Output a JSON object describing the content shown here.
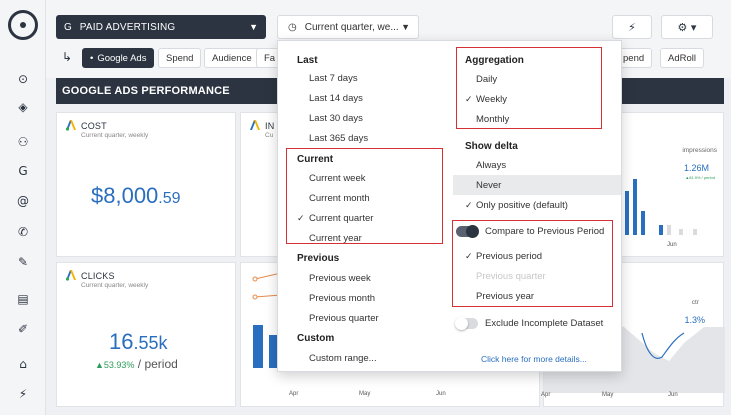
{
  "topbar": {
    "source_label": "PAID ADVERTISING",
    "date_label": "Current quarter, we...",
    "tabs": [
      {
        "label": "Google Ads",
        "active": true
      },
      {
        "label": "Spend"
      },
      {
        "label": "Audience"
      },
      {
        "label": "Fa"
      },
      {
        "label": "pend"
      },
      {
        "label": "AdRoll"
      }
    ]
  },
  "section": {
    "title": "GOOGLE ADS PERFORMANCE"
  },
  "cards": {
    "cost": {
      "title": "COST",
      "subtitle": "Current quarter, weekly",
      "value_main": "$8,000",
      "value_dec": ".59"
    },
    "clicks": {
      "title": "CLICKS",
      "subtitle": "Current quarter, weekly",
      "value_main": "16",
      "value_dec": ".55k",
      "delta_pct": "▲53.93%",
      "delta_suffix": " / period"
    },
    "impressions": {
      "label": "impressions",
      "value": "1.26M",
      "delta": "▲81.9% / period"
    },
    "ctr": {
      "label": "ctr",
      "value": "1.3%"
    },
    "partial_title": "IN",
    "partial_sub": "Cu"
  },
  "chart_axis": {
    "left": [
      "Apr",
      "May",
      "Jun"
    ],
    "right": [
      "Apr",
      "May",
      "Jun"
    ],
    "right_top": "Jun"
  },
  "dropdown": {
    "last": {
      "head": "Last",
      "items": [
        "Last 7 days",
        "Last 14 days",
        "Last 30 days",
        "Last 365 days"
      ]
    },
    "current": {
      "head": "Current",
      "items": [
        "Current week",
        "Current month",
        "Current quarter",
        "Current year"
      ],
      "selected": "Current quarter"
    },
    "previous": {
      "head": "Previous",
      "items": [
        "Previous week",
        "Previous month",
        "Previous quarter"
      ]
    },
    "custom": {
      "head": "Custom",
      "items": [
        "Custom range..."
      ]
    },
    "aggregation": {
      "head": "Aggregation",
      "items": [
        "Daily",
        "Weekly",
        "Monthly"
      ],
      "selected": "Weekly"
    },
    "show_delta": {
      "head": "Show delta",
      "items": [
        "Always",
        "Never",
        "Only positive (default)"
      ],
      "selected": "Only positive (default)"
    },
    "compare": {
      "label": "Compare to Previous Period",
      "on": true,
      "items": [
        "Previous period",
        "Previous quarter",
        "Previous year"
      ],
      "selected": "Previous period",
      "disabled": "Previous quarter"
    },
    "exclude": {
      "label": "Exclude Incomplete Dataset",
      "on": false
    },
    "details_link": "Click here for more details..."
  },
  "colors": {
    "dark": "#2b3440",
    "blue": "#2a6fbf",
    "highlight": "#d53034",
    "green": "#2e9c5a"
  },
  "sidebar_icons": [
    "compass-icon",
    "location-icon",
    "users-icon",
    "google-icon",
    "at-icon",
    "phone-icon",
    "edit-icon",
    "clipboard-icon",
    "pencil-icon",
    "bank-icon",
    "plugin-icon"
  ]
}
